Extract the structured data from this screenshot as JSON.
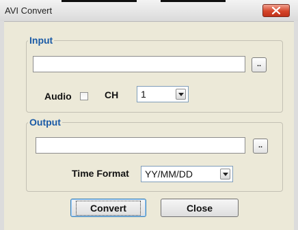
{
  "window": {
    "title": "AVI Convert"
  },
  "input_group": {
    "legend": "Input",
    "path_value": "",
    "browse_label": "..",
    "audio_label": "Audio",
    "audio_checked": false,
    "ch_label": "CH",
    "ch_value": "1"
  },
  "output_group": {
    "legend": "Output",
    "path_value": "",
    "browse_label": "..",
    "time_format_label": "Time Format",
    "time_format_value": "YY/MM/DD"
  },
  "buttons": {
    "convert": "Convert",
    "close": "Close"
  },
  "icons": {
    "close": "close-x-icon",
    "dropdown": "triangle-down-icon"
  },
  "colors": {
    "legend": "#1a5aa6",
    "close_button": "#d5452a",
    "dialog_bg": "#ece9d8"
  }
}
